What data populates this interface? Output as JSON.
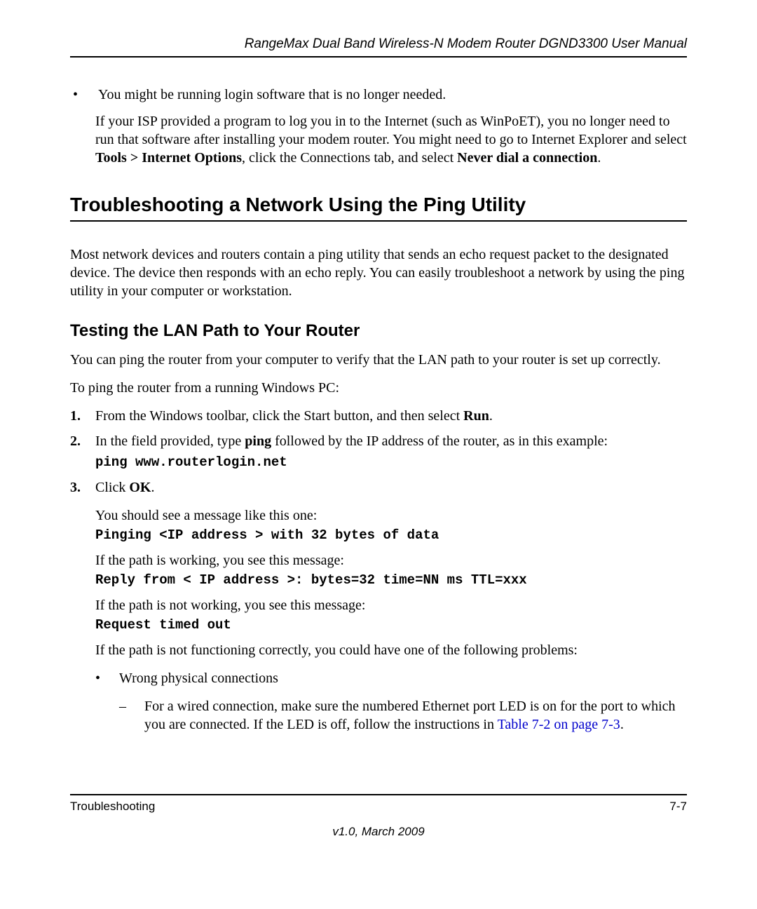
{
  "header": "RangeMax Dual Band Wireless-N Modem Router DGND3300 User Manual",
  "top_bullet": "You might be running login software that is no longer needed.",
  "top_para_pre": "If your ISP provided a program to log you in to the Internet (such as WinPoET), you no longer need to run that software after installing your modem router. You might need to go to Internet Explorer and select ",
  "top_bold1": "Tools > Internet Options",
  "top_mid": ", click the Connections tab, and select ",
  "top_bold2": "Never dial a connection",
  "top_end": ".",
  "h2": "Troubleshooting a Network Using the Ping Utility",
  "h2_para": "Most network devices and routers contain a ping utility that sends an echo request packet to the designated device. The device then responds with an echo reply. You can easily troubleshoot a network by using the ping utility in your computer or workstation.",
  "h3": "Testing the LAN Path to Your Router",
  "h3_para1": "You can ping the router from your computer to verify that the LAN path to your router is set up correctly.",
  "h3_para2": "To ping the router from a running Windows PC:",
  "step1_pre": "From the Windows toolbar, click the Start button, and then select ",
  "step1_bold": "Run",
  "step1_end": ".",
  "step2_pre": "In the field provided, type ",
  "step2_bold": "ping",
  "step2_post": " followed by the IP address of the router, as in this example:",
  "step2_code": "ping www.routerlogin.net",
  "step3_pre": "Click ",
  "step3_bold": "OK",
  "step3_end": ".",
  "msg_intro1": "You should see a message like this one:",
  "code1": "Pinging <IP address > with 32 bytes of data",
  "msg_intro2": "If the path is working, you see this message:",
  "code2": "Reply from < IP address >: bytes=32 time=NN ms TTL=xxx",
  "msg_intro3": "If the path is not working, you see this message:",
  "code3": "Request timed out",
  "msg_intro4": "If the path is not functioning correctly, you could have one of the following problems:",
  "inner_bullet": "Wrong physical connections",
  "inner_dash_pre": "For a wired connection, make sure the numbered Ethernet port LED is on for the port to which you are connected. If the LED is off, follow the instructions in ",
  "inner_dash_link": "Table 7-2 on page 7-3",
  "inner_dash_end": ".",
  "footer_left": "Troubleshooting",
  "footer_right": "7-7",
  "footer_version": "v1.0, March 2009"
}
